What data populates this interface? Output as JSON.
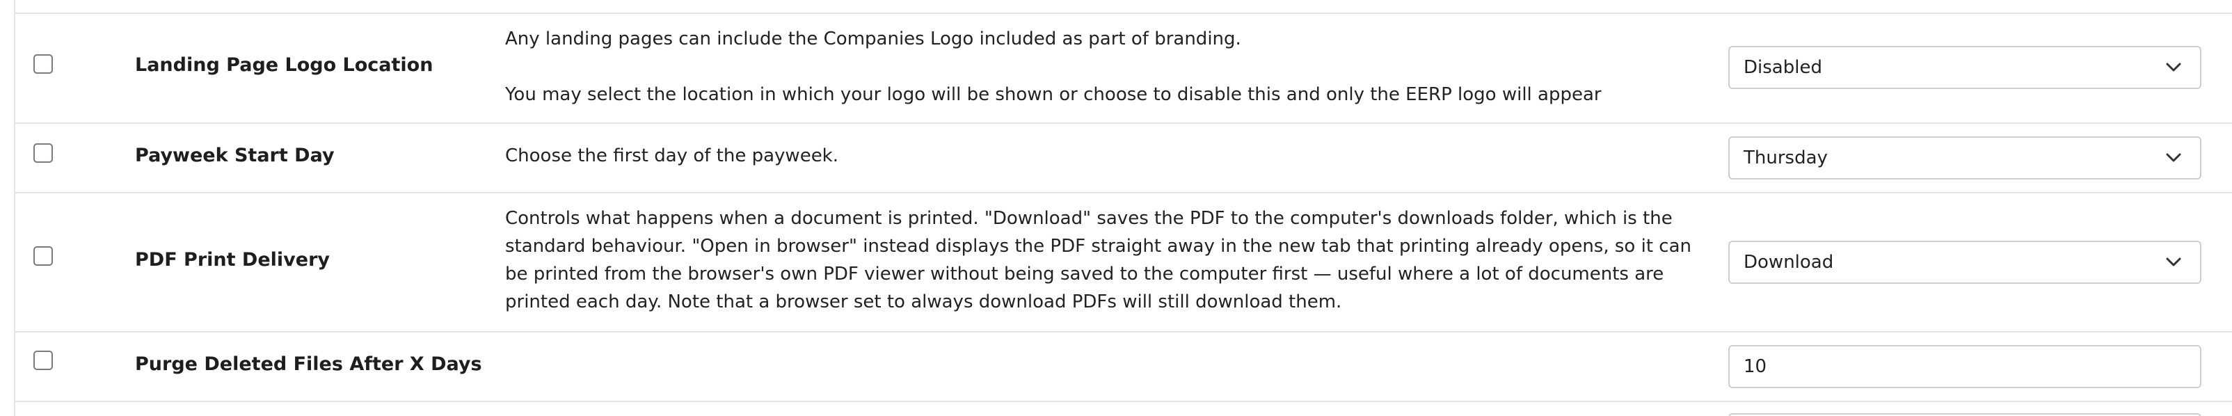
{
  "settings": [
    {
      "label": "Landing Page Logo Location",
      "description_lines": [
        "Any landing pages can include the Companies Logo included as part of branding.",
        "You may select the location in which your logo will be shown or choose to disable this and only the EERP logo will appear"
      ],
      "control_type": "select",
      "value": "Disabled"
    },
    {
      "label": "Payweek Start Day",
      "description": "Choose the first day of the payweek.",
      "control_type": "select",
      "value": "Thursday"
    },
    {
      "label": "PDF Print Delivery",
      "description": "Controls what happens when a document is printed. \"Download\" saves the PDF to the computer's downloads folder, which is the standard behaviour. \"Open in browser\" instead displays the PDF straight away in the new tab that printing already opens, so it can be printed from the browser's own PDF viewer without being saved to the computer first — useful where a lot of documents are printed each day. Note that a browser set to always download PDFs will still download them.",
      "control_type": "select",
      "value": "Download"
    },
    {
      "label": "Purge Deleted Files After X Days",
      "description": "",
      "control_type": "text",
      "value": "10"
    }
  ],
  "icons": {
    "dropdown": "chevron-down-icon"
  }
}
